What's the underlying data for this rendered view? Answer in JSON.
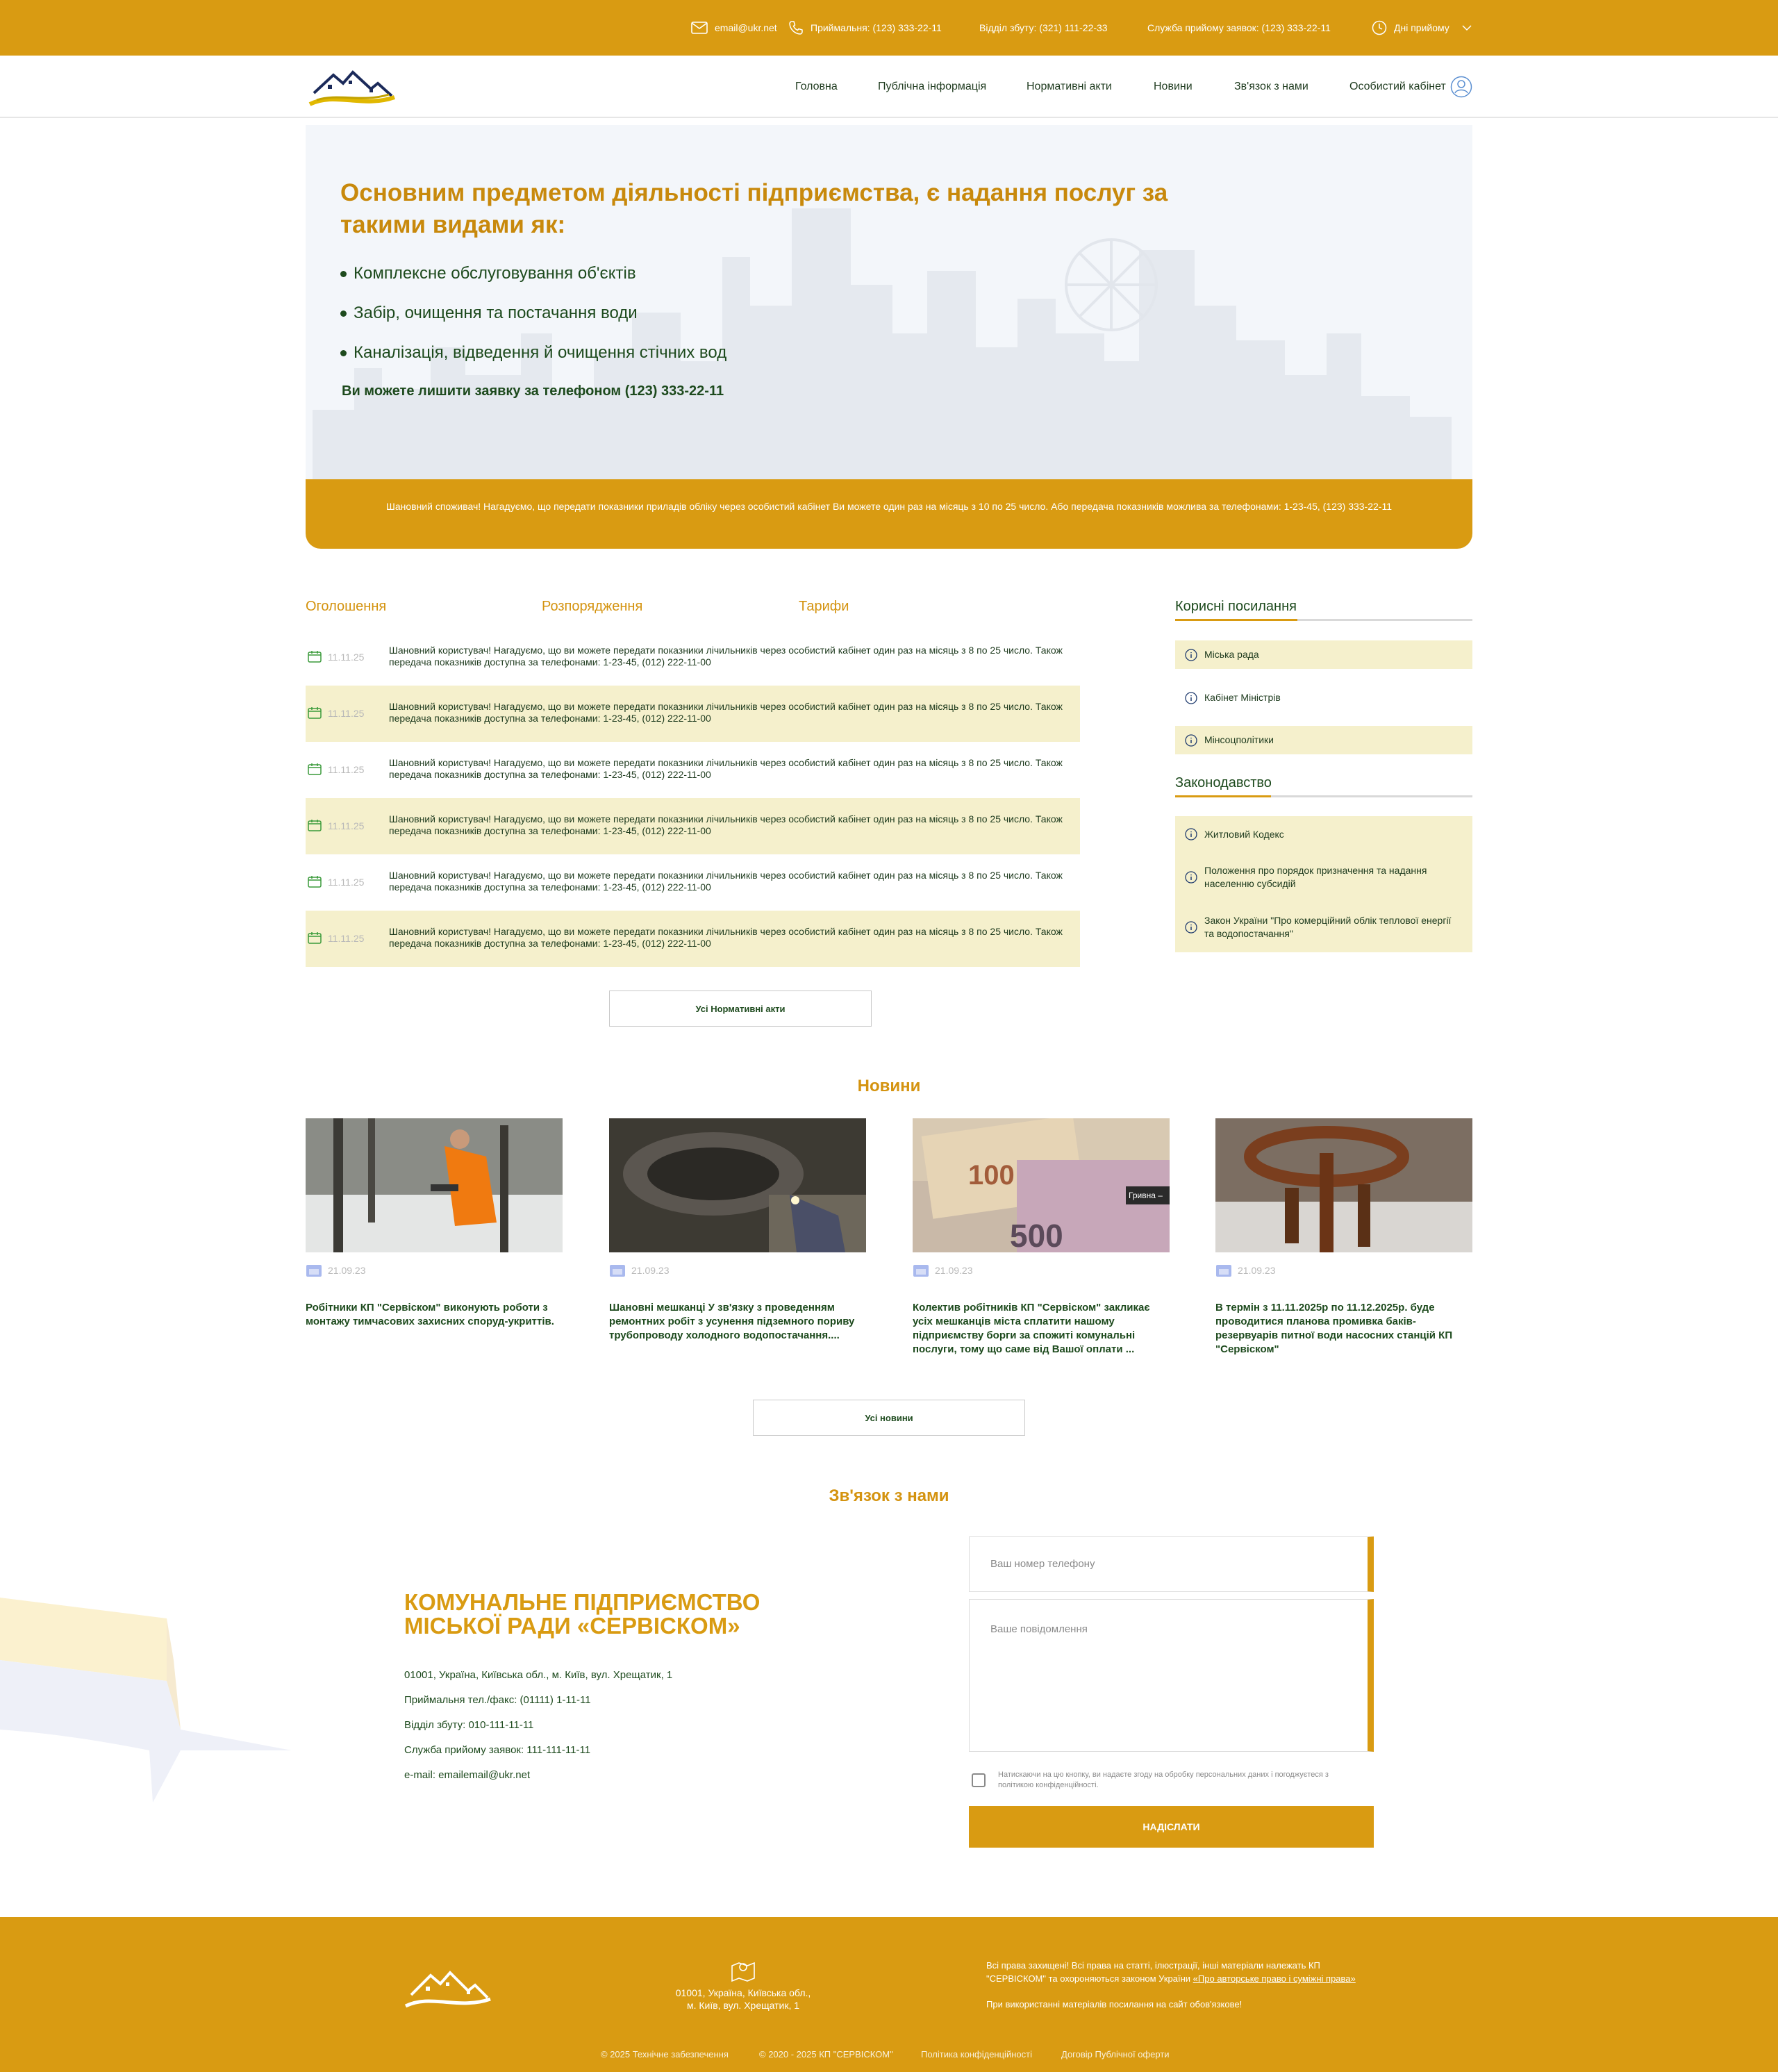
{
  "topbar": {
    "email": "email@ukr.net",
    "reception": "Приймальня: (123) 333-22-11",
    "sales": "Відділ збуту: (321) 111-22-33",
    "requests": "Служба прийому заявок: (123) 333-22-11",
    "reception_days": "Дні прийому"
  },
  "nav": {
    "items": [
      "Головна",
      "Публічна інформація",
      "Нормативні акти",
      "Новини",
      "Зв'язок з нами",
      "Особистий кабінет"
    ]
  },
  "hero": {
    "title": "Основним предметом діяльності підприємства, є надання послуг за такими видами як:",
    "services": [
      "Комплексне обслуговування об'єктів",
      "Забір, очищення та постачання води",
      "Каналізація, відведення й очищення стічних вод"
    ],
    "phone_text": "Ви можете лишити заявку за телефоном (123) 333-22-11"
  },
  "notice": "Шановний споживач! Нагадуємо, що передати показники приладів обліку через особистий кабінет Ви можете один раз на місяць з 10 по 25 число. Або передача показників можлива за телефонами: 1-23-45, (123) 333-22-11",
  "tabs": [
    "Оголошення",
    "Розпорядження",
    "Тарифи"
  ],
  "announcements": [
    {
      "date": "11.11.25",
      "text": "Шановний користувач! Нагадуємо, що ви можете передати показники лічильників через особистий кабінет один раз на місяць з 8 по 25 число. Також передача показників доступна за телефонами: 1-23-45, (012) 222-11-00"
    },
    {
      "date": "11.11.25",
      "text": "Шановний користувач! Нагадуємо, що ви можете передати показники лічильників через особистий кабінет один раз на місяць з 8 по 25 число. Також передача показників доступна за телефонами: 1-23-45, (012) 222-11-00"
    },
    {
      "date": "11.11.25",
      "text": "Шановний користувач! Нагадуємо, що ви можете передати показники лічильників через особистий кабінет один раз на місяць з 8 по 25 число. Також передача показників доступна за телефонами: 1-23-45, (012) 222-11-00"
    },
    {
      "date": "11.11.25",
      "text": "Шановний користувач! Нагадуємо, що ви можете передати показники лічильників через особистий кабінет один раз на місяць з 8 по 25 число. Також передача показників доступна за телефонами: 1-23-45, (012) 222-11-00"
    },
    {
      "date": "11.11.25",
      "text": "Шановний користувач! Нагадуємо, що ви можете передати показники лічильників через особистий кабінет один раз на місяць з 8 по 25 число. Також передача показників доступна за телефонами: 1-23-45, (012) 222-11-00"
    },
    {
      "date": "11.11.25",
      "text": "Шановний користувач! Нагадуємо, що ви можете передати показники лічильників через особистий кабінет один раз на місяць з 8 по 25 число. Також передача показників доступна за телефонами: 1-23-45, (012) 222-11-00"
    }
  ],
  "all_acts_button": "Усі Нормативні акти",
  "sidebar": {
    "useful_title": "Корисні посилання",
    "useful_links": [
      "Міська рада",
      "Кабінет Міністрів",
      "Мінсоцполітики"
    ],
    "law_title": "Законодавство",
    "law_links": [
      "Житловий Кодекс",
      "Положення про порядок призначення та надання населенню субсидій",
      "Закон України \"Про комерційний облік теплової енергії та водопостачання\""
    ]
  },
  "news": {
    "title": "Новини",
    "items": [
      {
        "date": "21.09.23",
        "title": "Робітники КП \"Сервіском\" виконують роботи з монтажу тимчасових захисних споруд-укриттів."
      },
      {
        "date": "21.09.23",
        "title": "Шановні мешканці У зв'язку з проведенням ремонтних робіт з усунення підземного пориву трубопроводу холодного водопостачання...."
      },
      {
        "date": "21.09.23",
        "title": "Колектив робітників КП \"Сервіском\" закликає усіх мешканців міста сплатити нашому підприємству борги за спожиті комунальні послуги, тому що саме від Вашої оплати ..."
      },
      {
        "date": "21.09.23",
        "title": "В термін з 11.11.2025р по 11.12.2025р. буде проводитися планова промивка баків-резервуарів питної води насосних станцій КП \"Сервіском\""
      }
    ],
    "banknote_label": "Гривна –",
    "all_news_button": "Усі новини"
  },
  "contact": {
    "title": "Зв'язок з нами",
    "org_line1": "КОМУНАЛЬНЕ ПІДПРИЄМСТВО",
    "org_line2": "МІСЬКОЇ РАДИ «СЕРВІСКОМ»",
    "address": "01001, Україна, Київська обл., м. Київ, вул. Хрещатик, 1",
    "reception": "Приймальня тел./факс: (01111) 1-11-11",
    "sales": "Відділ збуту: 010-111-11-11",
    "requests": "Служба прийому заявок: 111-111-11-11",
    "email": "e-mail: emailemail@ukr.net",
    "phone_placeholder": "Ваш номер телефону",
    "message_placeholder": "Ваше повідомлення",
    "consent": "Натискаючи на цю кнопку, ви надаєте згоду на обробку персональних даних і погоджуєтеся з політикою конфіденційності.",
    "submit": "НАДІСЛАТИ"
  },
  "footer": {
    "address_line1": "01001, Україна, Київська обл.,",
    "address_line2": "м. Київ, вул. Хрещатик, 1",
    "rights_text": "Всі права захищені! Всі права на статті, ілюстрації, інші матеріали належать КП \"СЕРВІСКОМ\" та охороняються законом України",
    "rights_link": "«Про авторське право і суміжні права»",
    "rights_note": "При використанні матеріалів посилання на сайт обов'язкове!",
    "bottom_links": [
      "© 2025 Технічне забезпечення",
      "© 2020 - 2025 КП \"СЕРВІСКОМ\"",
      "Політика конфіденційності",
      "Договір Публічної оферти"
    ]
  },
  "colors": {
    "accent": "#d99b12",
    "text_green": "#1d4a1d",
    "highlight": "#f5f0cc",
    "hero_bg": "#f3f6fa"
  }
}
